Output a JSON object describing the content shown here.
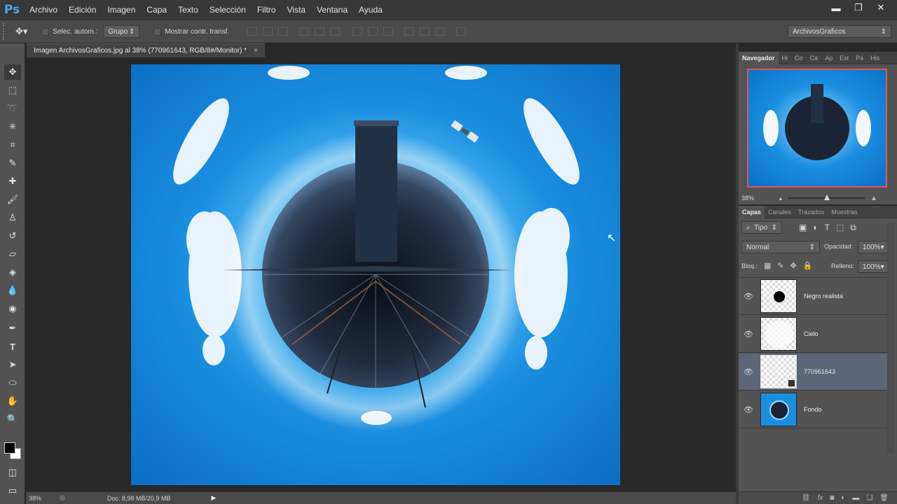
{
  "app": {
    "logo": "Ps",
    "menu": [
      "Archivo",
      "Edición",
      "Imagen",
      "Capa",
      "Texto",
      "Selección",
      "Filtro",
      "Vista",
      "Ventana",
      "Ayuda"
    ],
    "window_controls": [
      "▬",
      "❐",
      "✕"
    ]
  },
  "options": {
    "auto_select_label": "Selec. autom.:",
    "group_value": "Grupo",
    "transform_label": "Mostrar contr. transf.",
    "workspace": "ArchivosGraficos"
  },
  "document": {
    "tab_title": "Imagen ArchivosGraficos.jpg al 38% (770961643, RGB/8#/Monitor) *",
    "tab_close": "×"
  },
  "status": {
    "zoom": "38%",
    "doc_info": "Doc: 8,98 MB/20,9 MB",
    "arrow": "▶"
  },
  "navigator": {
    "tabs": [
      "Navegador",
      "Hi",
      "Co",
      "Ca",
      "Ap",
      "Est",
      "Pá",
      "His"
    ],
    "zoom": "38%"
  },
  "layers": {
    "tabs": [
      "Capas",
      "Canales",
      "Trazados",
      "Muestras"
    ],
    "filter": "Tipo",
    "blend_mode": "Normal",
    "opacity_label": "Opacidad:",
    "opacity_value": "100%",
    "lock_label": "Bloq.:",
    "fill_label": "Relleno:",
    "fill_value": "100%",
    "items": [
      {
        "name": "Negro realista",
        "visible": true,
        "selected": false
      },
      {
        "name": "Cielo",
        "visible": true,
        "selected": false
      },
      {
        "name": "770961643",
        "visible": true,
        "selected": true
      },
      {
        "name": "Fondo",
        "visible": true,
        "selected": false
      }
    ],
    "bottom_icons": [
      "link-icon",
      "fx-icon",
      "mask-icon",
      "adjustment-icon",
      "folder-icon",
      "new-layer-icon",
      "trash-icon"
    ]
  },
  "colors": {
    "sky": "#1a8fe0",
    "panel": "#535353",
    "selected_layer": "#5d6677"
  }
}
